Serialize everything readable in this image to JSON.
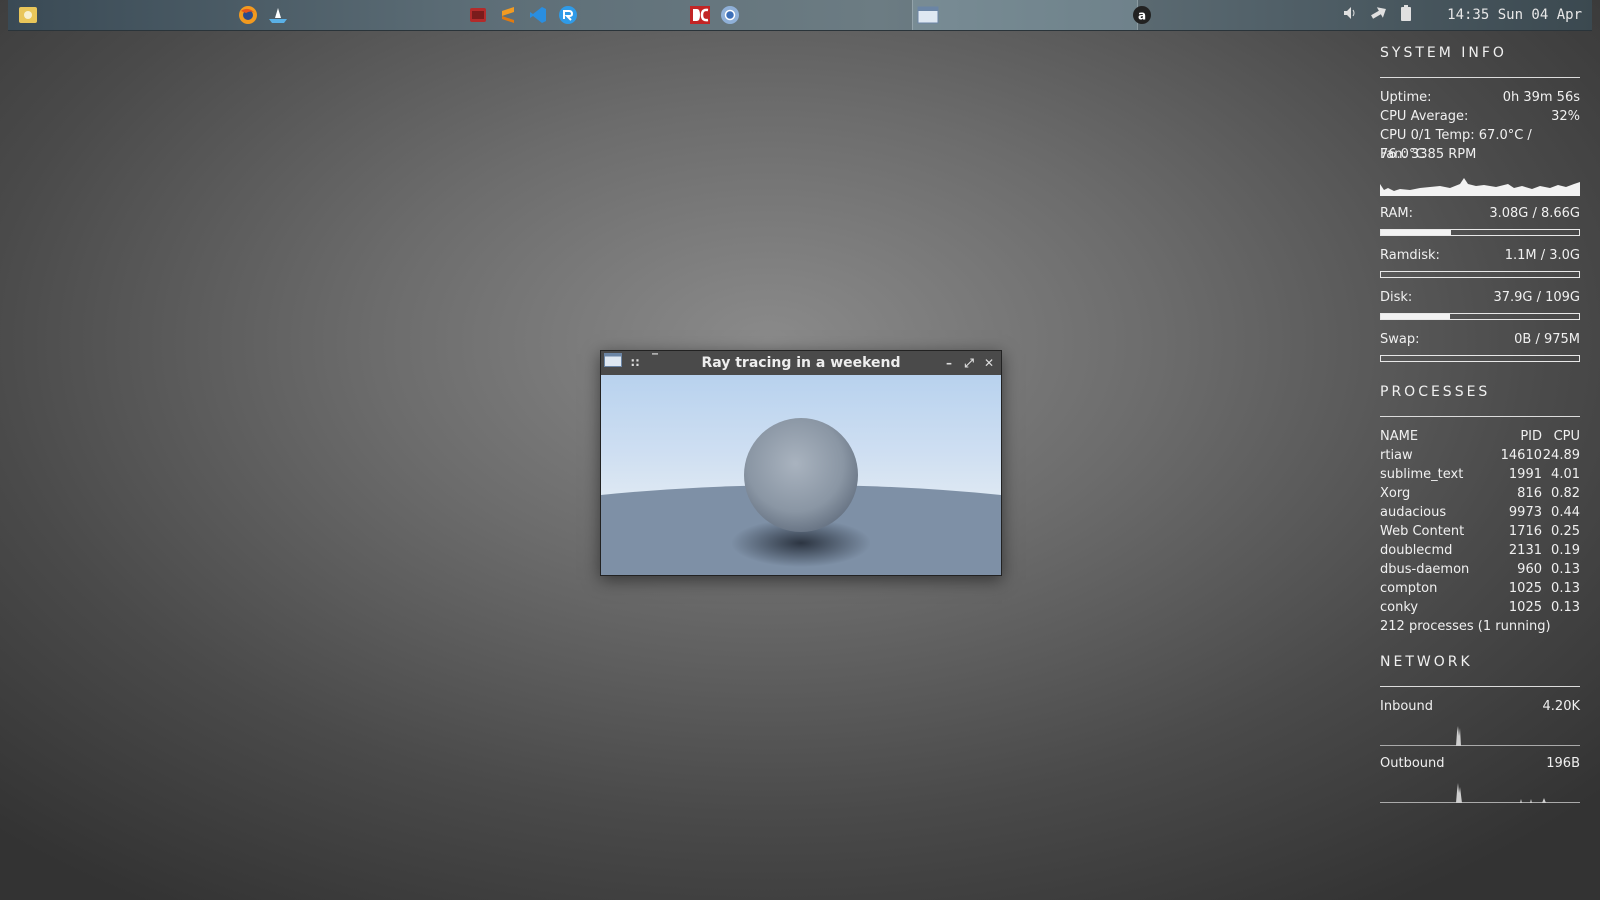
{
  "taskbar": {
    "clock": "14:35 Sun 04 Apr"
  },
  "window": {
    "title": "Ray tracing in a weekend"
  },
  "conky": {
    "system_heading": "SYSTEM INFO",
    "uptime_label": "Uptime:",
    "uptime_value": "0h 39m 56s",
    "cpu_avg_label": "CPU Average:",
    "cpu_avg_value": "32%",
    "cpu_temp": "CPU 0/1 Temp: 67.0°C / 76.0°C",
    "fan": "Fan: 3385 RPM",
    "ram_label": "RAM:",
    "ram_value": "3.08G / 8.66G",
    "ram_fraction": 0.355,
    "ramdisk_label": "Ramdisk:",
    "ramdisk_value": "1.1M / 3.0G",
    "ramdisk_fraction": 0.0,
    "disk_label": "Disk:",
    "disk_value": "37.9G / 109G",
    "disk_fraction": 0.347,
    "swap_label": "Swap:",
    "swap_value": "0B / 975M",
    "swap_fraction": 0.0,
    "processes_heading": "PROCESSES",
    "proc_headers": {
      "name": "NAME",
      "pid": "PID",
      "cpu": "CPU"
    },
    "processes": [
      {
        "name": "rtiaw",
        "pid": "14610",
        "cpu": "24.89"
      },
      {
        "name": "sublime_text",
        "pid": "1991",
        "cpu": "4.01"
      },
      {
        "name": "Xorg",
        "pid": "816",
        "cpu": "0.82"
      },
      {
        "name": "audacious",
        "pid": "9973",
        "cpu": "0.44"
      },
      {
        "name": "Web Content",
        "pid": "1716",
        "cpu": "0.25"
      },
      {
        "name": "doublecmd",
        "pid": "2131",
        "cpu": "0.19"
      },
      {
        "name": "dbus-daemon",
        "pid": "960",
        "cpu": "0.13"
      },
      {
        "name": "compton",
        "pid": "1025",
        "cpu": "0.13"
      },
      {
        "name": "conky",
        "pid": "1025",
        "cpu": "0.13"
      }
    ],
    "proc_summary": "212 processes (1 running)",
    "network_heading": "NETWORK",
    "inbound_label": "Inbound",
    "inbound_value": "4.20K",
    "outbound_label": "Outbound",
    "outbound_value": "196B"
  }
}
